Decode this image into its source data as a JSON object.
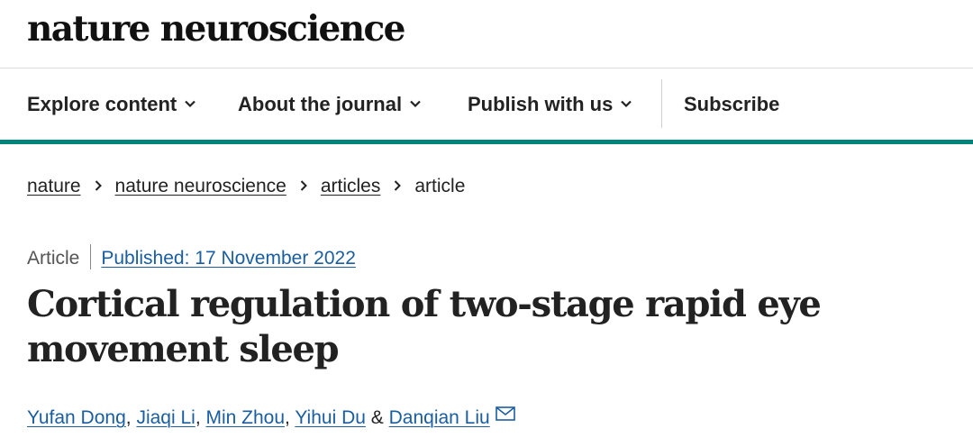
{
  "site": {
    "masthead": "nature neuroscience"
  },
  "nav": {
    "items": [
      {
        "label": "Explore content",
        "icon": "chevron-down-icon"
      },
      {
        "label": "About the journal",
        "icon": "chevron-down-icon"
      },
      {
        "label": "Publish with us",
        "icon": "chevron-down-icon"
      },
      {
        "label": "Subscribe"
      }
    ],
    "accent_color": "#01857a"
  },
  "breadcrumb": {
    "items": [
      "nature",
      "nature neuroscience",
      "articles"
    ],
    "current": "article",
    "separator_icon": "chevron-right-icon"
  },
  "article": {
    "type": "Article",
    "published": "Published: 17 November 2022",
    "title": "Cortical regulation of two-stage rapid eye movement sleep",
    "authors": [
      "Yufan Dong",
      "Jiaqi Li",
      "Min Zhou",
      "Yihui Du",
      "Danqian Liu"
    ],
    "author_separator": ", ",
    "author_conjunction": " & ",
    "contact_icon": "mail-icon",
    "link_color": "#1a5ea1"
  }
}
